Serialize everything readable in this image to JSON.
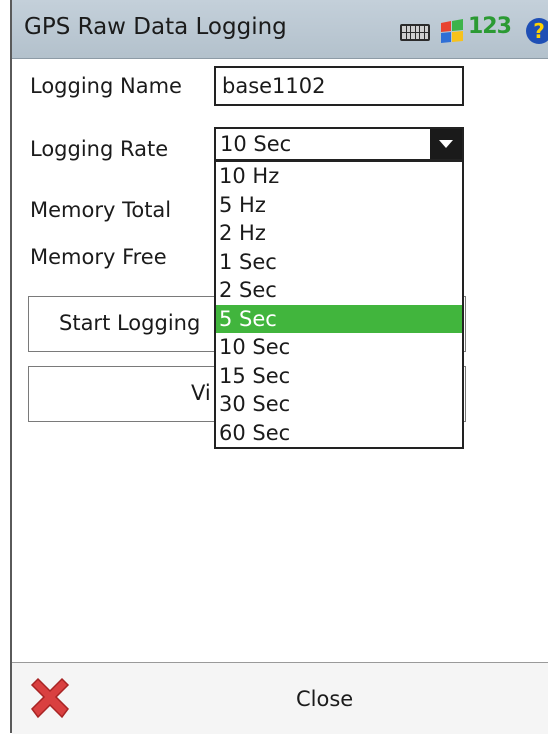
{
  "window": {
    "title": "GPS Raw Data Logging"
  },
  "tray": {
    "input_mode": "123"
  },
  "form": {
    "logging_name_label": "Logging Name",
    "logging_name_value": "base1102",
    "logging_rate_label": "Logging Rate",
    "logging_rate_value": "10 Sec",
    "memory_total_label": "Memory Total",
    "memory_free_label": "Memory Free"
  },
  "buttons": {
    "start_logging": "Start Logging",
    "view_partial": "Vi",
    "close": "Close"
  },
  "dropdown": {
    "options": [
      "10 Hz",
      "5 Hz",
      "2 Hz",
      "1 Sec",
      "2 Sec",
      "5 Sec",
      "10 Sec",
      "15 Sec",
      "30 Sec",
      "60 Sec"
    ],
    "highlighted": "5 Sec"
  },
  "colors": {
    "titlebar": "#b9c6d0",
    "highlight": "#41b53d"
  }
}
